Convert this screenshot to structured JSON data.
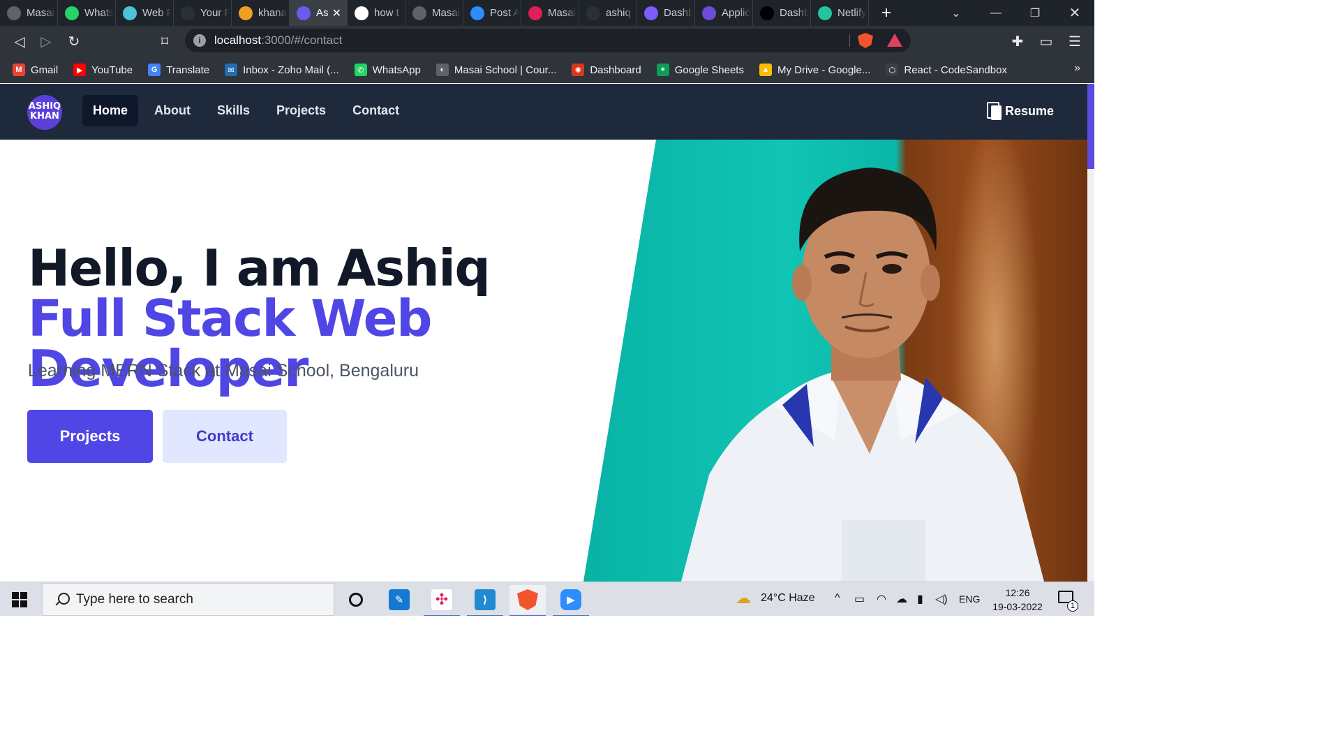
{
  "browser": {
    "tabs": [
      {
        "label": "Masai",
        "icon": "globe-icon",
        "color": "#5f6368"
      },
      {
        "label": "WhatsApp",
        "icon": "whatsapp-icon",
        "color": "#25d366"
      },
      {
        "label": "Web F",
        "icon": "web-icon",
        "color": "#4cc3d9"
      },
      {
        "label": "Your F",
        "icon": "github-icon",
        "color": "#2b2f36"
      },
      {
        "label": "khana",
        "icon": "codeforces-icon",
        "color": "#f0a020"
      },
      {
        "label": "As",
        "icon": "app-icon",
        "color": "#6b5bf0",
        "active": true
      },
      {
        "label": "how t",
        "icon": "google-icon",
        "color": "#ffffff"
      },
      {
        "label": "Masai",
        "icon": "globe-icon",
        "color": "#5f6368"
      },
      {
        "label": "Post A",
        "icon": "zoom-icon",
        "color": "#2d8cff"
      },
      {
        "label": "Masai",
        "icon": "slack-icon",
        "color": "#e01e5a"
      },
      {
        "label": "ashiq",
        "icon": "github-icon",
        "color": "#2b2f36"
      },
      {
        "label": "Dashb",
        "icon": "check-icon",
        "color": "#7c5cff"
      },
      {
        "label": "Applic",
        "icon": "list-icon",
        "color": "#6d4bd8"
      },
      {
        "label": "Dashb",
        "icon": "triangle-icon",
        "color": "#000000"
      },
      {
        "label": "Netlify",
        "icon": "netlify-icon",
        "color": "#25c2a0"
      }
    ],
    "url_host": "localhost",
    "url_rest": ":3000/#/contact",
    "bookmarks": [
      {
        "label": "Gmail",
        "icon": "gmail-icon",
        "color": "#ea4335",
        "glyph": "M"
      },
      {
        "label": "YouTube",
        "icon": "youtube-icon",
        "color": "#ff0000",
        "glyph": "▶"
      },
      {
        "label": "Translate",
        "icon": "translate-icon",
        "color": "#4285f4",
        "glyph": "G"
      },
      {
        "label": "Inbox - Zoho Mail (...",
        "icon": "zoho-mail-icon",
        "color": "#226db4",
        "glyph": "✉"
      },
      {
        "label": "WhatsApp",
        "icon": "whatsapp-icon",
        "color": "#25d366",
        "glyph": "✆"
      },
      {
        "label": "Masai School | Cour...",
        "icon": "globe-icon",
        "color": "#5f6368",
        "glyph": "◐"
      },
      {
        "label": "Dashboard",
        "icon": "dashboard-icon",
        "color": "#d9381e",
        "glyph": "✺"
      },
      {
        "label": "Google Sheets",
        "icon": "sheets-icon",
        "color": "#0f9d58",
        "glyph": "+"
      },
      {
        "label": "My Drive - Google...",
        "icon": "drive-icon",
        "color": "#fbbc04",
        "glyph": "▲"
      },
      {
        "label": "React - CodeSandbox",
        "icon": "codesandbox-icon",
        "color": "#3a3f47",
        "glyph": "⬡"
      }
    ]
  },
  "site": {
    "logo_line1": "ASHIQ",
    "logo_line2": "KHAN",
    "nav": [
      "Home",
      "About",
      "Skills",
      "Projects",
      "Contact"
    ],
    "resume_label": "Resume",
    "headline_plain": "Hello, I am Ashiq ",
    "headline_accent": "Full Stack Web Developer",
    "subline": "Learning MERN Stack at Masai School, Bengaluru",
    "btn_primary": "Projects",
    "btn_secondary": "Contact",
    "accent_color": "#4f46e5"
  },
  "taskbar": {
    "search_placeholder": "Type here to search",
    "weather": "24°C  Haze",
    "language": "ENG",
    "time": "12:26",
    "date": "19-03-2022",
    "notifications": "1"
  }
}
